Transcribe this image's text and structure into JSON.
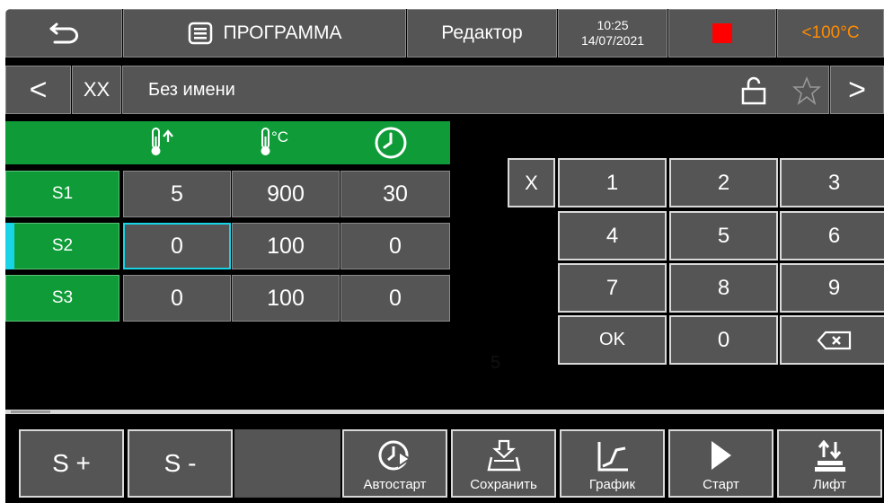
{
  "header": {
    "title": "ПРОГРАММА",
    "mode": "Редактор",
    "time": "10:25",
    "date": "14/07/2021",
    "temp_alert": "<100°C",
    "alert_color": "#ff8c00",
    "stop_color": "#ff0000"
  },
  "nav": {
    "prev": "<",
    "next": ">",
    "program_number": "XX",
    "program_name": "Без имени"
  },
  "table": {
    "header_color": "#0f9c38",
    "column_icons": [
      "temperature-rise-icon",
      "temperature-celsius-icon",
      "clock-icon"
    ],
    "column_units": [
      "°C"
    ],
    "rows": [
      {
        "label": "S1",
        "values": [
          "5",
          "900",
          "30"
        ]
      },
      {
        "label": "S2",
        "values": [
          "0",
          "100",
          "0"
        ]
      },
      {
        "label": "S3",
        "values": [
          "0",
          "100",
          "0"
        ]
      }
    ],
    "selected_row": 1,
    "selected_color": "#19d3e6"
  },
  "keypad": {
    "clear": "X",
    "keys": [
      "1",
      "2",
      "3",
      "4",
      "5",
      "6",
      "7",
      "8",
      "9",
      "OK",
      "0"
    ],
    "backspace_icon": "backspace-icon"
  },
  "entry_value": "5",
  "bottom": {
    "add_step": "S +",
    "remove_step": "S -",
    "autostart": "Автостарт",
    "save": "Сохранить",
    "graph": "График",
    "start": "Старт",
    "lift": "Лифт"
  }
}
